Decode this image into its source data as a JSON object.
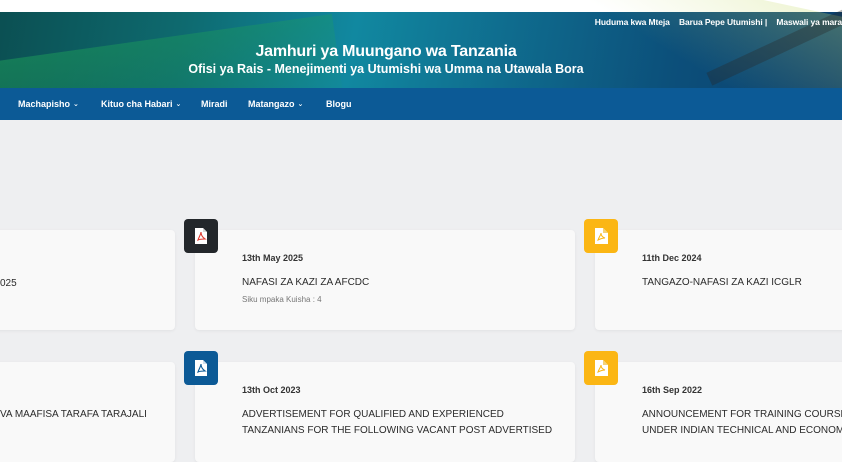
{
  "header": {
    "top_links": [
      "Huduma kwa Mteja",
      "Barua Pepe Utumishi |",
      "Maswali ya mara"
    ],
    "title": "Jamhuri ya Muungano wa Tanzania",
    "subtitle": "Ofisi ya Rais - Menejimenti ya Utumishi wa Umma na Utawala Bora"
  },
  "nav": {
    "items": [
      {
        "label": "Machapisho",
        "dropdown": true
      },
      {
        "label": "Kituo cha Habari",
        "dropdown": true
      },
      {
        "label": "Miradi",
        "dropdown": false
      },
      {
        "label": "Matangazo",
        "dropdown": true
      },
      {
        "label": "Blogu",
        "dropdown": false
      }
    ],
    "caret": "⌄"
  },
  "colors": {
    "nav_bg": "#0c5a96",
    "badge_dark": "#23272b",
    "badge_blue": "#0c5a96",
    "badge_yellow": "#fbb614",
    "page_bg": "#eeeff1"
  },
  "cards": [
    {
      "icon": "pdf-icon",
      "date": "",
      "lines": [
        "025"
      ],
      "meta": ""
    },
    {
      "icon": "pdf-icon",
      "date": "13th May 2025",
      "lines": [
        "NAFASI ZA KAZI ZA AFCDC"
      ],
      "meta": "Siku mpaka Kuisha : 4"
    },
    {
      "icon": "document-icon",
      "date": "11th Dec 2024",
      "lines": [
        "TANGAZO-NAFASI ZA KAZI ICGLR"
      ],
      "meta": ""
    },
    {
      "icon": "pdf-icon",
      "date": "",
      "lines": [
        "VA MAAFISA TARAFA TARAJALI"
      ],
      "meta": ""
    },
    {
      "icon": "pdf-icon",
      "date": "13th Oct 2023",
      "lines": [
        "ADVERTISEMENT FOR QUALIFIED AND EXPERIENCED",
        "TANZANIANS FOR THE FOLLOWING VACANT POST ADVERTISED"
      ],
      "meta": ""
    },
    {
      "icon": "document-icon",
      "date": "16th Sep 2022",
      "lines": [
        "ANNOUNCEMENT FOR TRAINING COURSES",
        "UNDER INDIAN TECHNICAL AND ECONOM"
      ],
      "meta": ""
    }
  ]
}
